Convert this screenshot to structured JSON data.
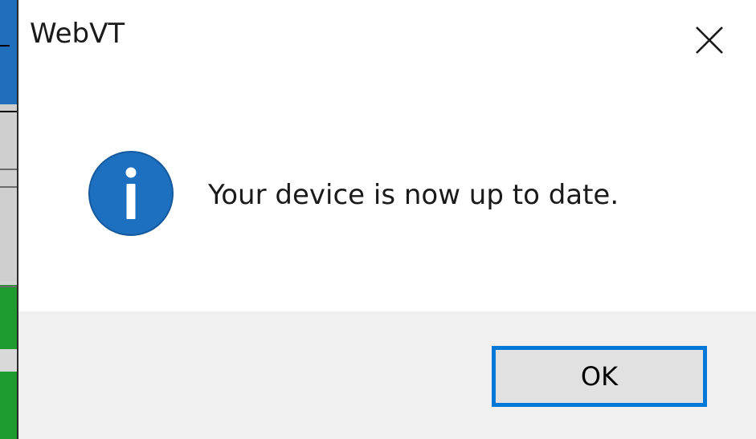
{
  "window": {
    "title": "WebVT"
  },
  "dialog": {
    "message": "Your device is now up to date.",
    "icon": "information-icon",
    "ok_label": "OK",
    "close_icon": "close-icon"
  },
  "colors": {
    "accent": "#0078d7",
    "info_icon_fill": "#1d6fbf",
    "footer_background": "#f0f0f0",
    "button_background": "#e1e1e1"
  }
}
